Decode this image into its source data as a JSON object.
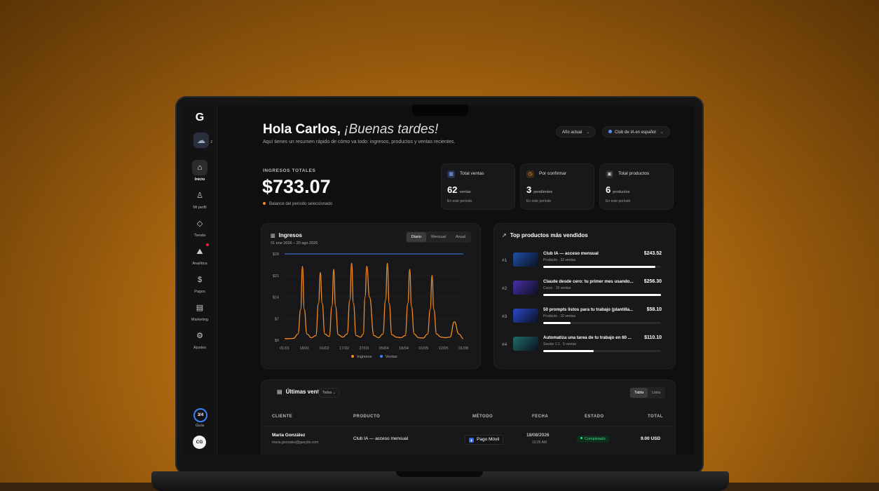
{
  "sidebar": {
    "logo": "G",
    "items": [
      {
        "label": "Inicio",
        "icon": "home-icon",
        "glyph": "⌂",
        "active": true
      },
      {
        "label": "Mi perfil",
        "icon": "user-icon",
        "glyph": "♙"
      },
      {
        "label": "Tienda",
        "icon": "tag-icon",
        "glyph": "◇"
      },
      {
        "label": "Analítica",
        "icon": "analytics-icon",
        "glyph": "⛰"
      },
      {
        "label": "Pagos",
        "icon": "dollar-icon",
        "glyph": "$"
      },
      {
        "label": "Marketing",
        "icon": "briefcase-icon",
        "glyph": "▤"
      },
      {
        "label": "Ajustes",
        "icon": "gear-icon",
        "glyph": "⚙"
      }
    ],
    "guide_progress": "3/4",
    "guide_label": "Guía",
    "avatar_initials": "CG"
  },
  "header": {
    "greeting": "Hola Carlos,",
    "greeting_italic": "¡Buenas tardes!",
    "subtitle": "Aquí tienes un resumen rápido de cómo va todo: ingresos, productos y ventas recientes.",
    "period_select": "Año actual",
    "club_select": "Club de IA en español"
  },
  "income": {
    "label": "INGRESOS TOTALES",
    "value": "$733.07",
    "note": "Balance del período seleccionado"
  },
  "stats": [
    {
      "title": "Total ventas",
      "number": "62",
      "unit": "ventas",
      "period": "En este período"
    },
    {
      "title": "Por confirmar",
      "number": "3",
      "unit": "pendientes",
      "period": "En este período"
    },
    {
      "title": "Total productos",
      "number": "6",
      "unit": "productos",
      "period": "En este período"
    }
  ],
  "income_chart": {
    "title": "Ingresos",
    "range": "01 ene 2026 – 20 ago 2026",
    "tabs": [
      "Diario",
      "Mensual",
      "Anual"
    ],
    "active_tab": "Diario",
    "legend": [
      "Ingresos",
      "Ventas"
    ]
  },
  "chart_data": {
    "type": "line",
    "title": "Ingresos",
    "xlabel": "",
    "ylabel": "",
    "ylim": [
      0,
      28
    ],
    "yticks": [
      "$0",
      "$7",
      "$14",
      "$21",
      "$28"
    ],
    "x_tick_labels": [
      "01/01",
      "18/01",
      "01/02",
      "17/02",
      "27/03",
      "05/04",
      "18/04",
      "01/05",
      "12/05",
      "01/08"
    ],
    "series": [
      {
        "name": "Ingresos",
        "color": "#f08a24",
        "x": [
          0,
          5,
          10,
          15,
          18,
          20,
          22,
          25,
          30,
          35,
          38,
          40,
          42,
          45,
          50,
          53,
          55,
          57,
          60,
          65,
          70,
          73,
          75,
          77,
          80,
          85,
          88,
          90,
          92,
          95,
          100,
          105,
          110,
          113,
          115,
          117,
          120,
          125,
          130,
          135,
          138,
          140,
          142,
          145,
          150,
          155,
          160,
          163,
          165,
          167,
          170,
          175,
          180,
          185,
          190,
          195,
          200
        ],
        "y": [
          0.5,
          0.5,
          0.6,
          2,
          10,
          24,
          10,
          2,
          0.8,
          1.5,
          12,
          22,
          12,
          2,
          1.2,
          11,
          23,
          11,
          1.8,
          1,
          2,
          13,
          25,
          12,
          1.5,
          1,
          2,
          14,
          24,
          14,
          1.5,
          0.8,
          2,
          13,
          25,
          12,
          1.8,
          1,
          0.8,
          1.5,
          12,
          23,
          11,
          2,
          0.8,
          0.7,
          2,
          10,
          21,
          10,
          2,
          1,
          0.8,
          1,
          6,
          2,
          0.5
        ]
      },
      {
        "name": "Ventas",
        "color": "#3b82f6",
        "x": [
          0,
          200
        ],
        "y": [
          28,
          28
        ]
      }
    ]
  },
  "top_products": {
    "title": "Top productos más vendidos",
    "items": [
      {
        "rank": "#1",
        "name": "Club IA — acceso mensual",
        "desc": "Producto · 32 ventas",
        "price": "$243.52",
        "share": 0.95,
        "thumb": "#1e4fa8"
      },
      {
        "rank": "#2",
        "name": "Claude desde cero: tu primer mes usando...",
        "desc": "Curso · 10 ventas",
        "price": "$256.30",
        "share": 1.0,
        "thumb": "#4a2fa8"
      },
      {
        "rank": "#3",
        "name": "50 prompts listos para tu trabajo (plantilla...",
        "desc": "Producto · 10 ventas",
        "price": "$58.10",
        "share": 0.23,
        "thumb": "#2a48c8"
      },
      {
        "rank": "#4",
        "name": "Automatiza una tarea de tu trabajo en 60 ...",
        "desc": "Sesión 1:1 · 5 ventas",
        "price": "$110.10",
        "share": 0.43,
        "thumb": "#1f6d66"
      }
    ]
  },
  "latest_sales": {
    "title": "Últimas ventas",
    "filter": "Todas",
    "views": [
      "Tabla",
      "Lista"
    ],
    "active_view": "Tabla",
    "columns": [
      "CLIENTE",
      "PRODUCTO",
      "MÉTODO",
      "FECHA",
      "ESTADO",
      "TOTAL"
    ],
    "rows": [
      {
        "client": "María González",
        "email": "maria.gonzalez@gueybo.com",
        "product": "Club IA — acceso mensual",
        "method": "Pago Móvil",
        "date": "18/08/2026",
        "time": "10:26 AM",
        "status": "Completado",
        "total": "9.00 USD"
      }
    ]
  }
}
